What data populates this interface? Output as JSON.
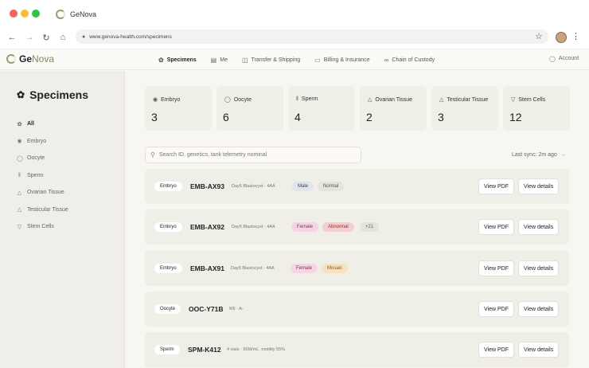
{
  "browser": {
    "tab_title": "GeNova",
    "url": "www.genova-health.com/specimens",
    "icons": [
      "back-icon",
      "forward-icon",
      "reload-icon",
      "home-icon",
      "lock-icon",
      "star-icon",
      "profile-avatar",
      "kebab-menu-icon"
    ]
  },
  "app": {
    "brand_ge": "Ge",
    "brand_nova": "Nova",
    "nav": [
      {
        "label": "Specimens",
        "icon": "specimens-icon",
        "active": true
      },
      {
        "label": "Me",
        "icon": "clipboard-icon",
        "active": false
      },
      {
        "label": "Transfer & Shipping",
        "icon": "truck-icon",
        "active": false
      },
      {
        "label": "Billing & Insurance",
        "icon": "card-icon",
        "active": false
      },
      {
        "label": "Chain of Custody",
        "icon": "chain-icon",
        "active": false
      }
    ],
    "account": "Account"
  },
  "sidebar": {
    "title": "Specimens",
    "items": [
      {
        "label": "All",
        "active": true
      },
      {
        "label": "Embryo",
        "active": false
      },
      {
        "label": "Oocyte",
        "active": false
      },
      {
        "label": "Sperm",
        "active": false
      },
      {
        "label": "Ovarian Tissue",
        "active": false
      },
      {
        "label": "Testicular Tissue",
        "active": false
      },
      {
        "label": "Stem Cells",
        "active": false
      }
    ]
  },
  "stats": [
    {
      "label": "Embryo",
      "value": "3"
    },
    {
      "label": "Oocyte",
      "value": "6"
    },
    {
      "label": "Sperm",
      "value": "4"
    },
    {
      "label": "Ovarian Tissue",
      "value": "2"
    },
    {
      "label": "Testicular Tissue",
      "value": "3"
    },
    {
      "label": "Stem Cells",
      "value": "12"
    }
  ],
  "search": {
    "placeholder": "Search ID, genetics, tank telemetry nominal"
  },
  "sync": {
    "label": "Last sync: 2m ago",
    "arrow": "→"
  },
  "rows": [
    {
      "type": "Embryo",
      "id": "EMB-AX93",
      "meta": "Day5 Blastocyst · 4AA",
      "tags": [
        {
          "text": "Male",
          "bg": "#dfe5ea",
          "fg": "#445"
        },
        {
          "text": "Normal",
          "bg": "#e3e6d7",
          "fg": "#555"
        }
      ],
      "pdf": "View PDF",
      "details": "View details"
    },
    {
      "type": "Embryo",
      "id": "EMB-AX92",
      "meta": "Day5 Blastocyst · 4AA",
      "tags": [
        {
          "text": "Female",
          "bg": "#f7d4e4",
          "fg": "#8a2b55"
        },
        {
          "text": "Abnormal",
          "bg": "#f5cfcf",
          "fg": "#9a2a2a"
        },
        {
          "text": "+21",
          "bg": "#e4e3dc",
          "fg": "#666"
        }
      ],
      "pdf": "View PDF",
      "details": "View details"
    },
    {
      "type": "Embryo",
      "id": "EMB-AX91",
      "meta": "Day5 Blastocyst · 4AA",
      "tags": [
        {
          "text": "Female",
          "bg": "#f7d4e4",
          "fg": "#8a2b55"
        },
        {
          "text": "Mosaic",
          "bg": "#f7e2bd",
          "fg": "#8a5a17"
        }
      ],
      "pdf": "View PDF",
      "details": "View details"
    },
    {
      "type": "Oocyte",
      "id": "OOC-Y71B",
      "meta": "MII · A-",
      "tags": [],
      "pdf": "View PDF",
      "details": "View details"
    },
    {
      "type": "Sperm",
      "id": "SPM-K412",
      "meta": "4 vials · 65M/mL, motility 55%",
      "tags": [],
      "pdf": "View PDF",
      "details": "View details"
    }
  ]
}
